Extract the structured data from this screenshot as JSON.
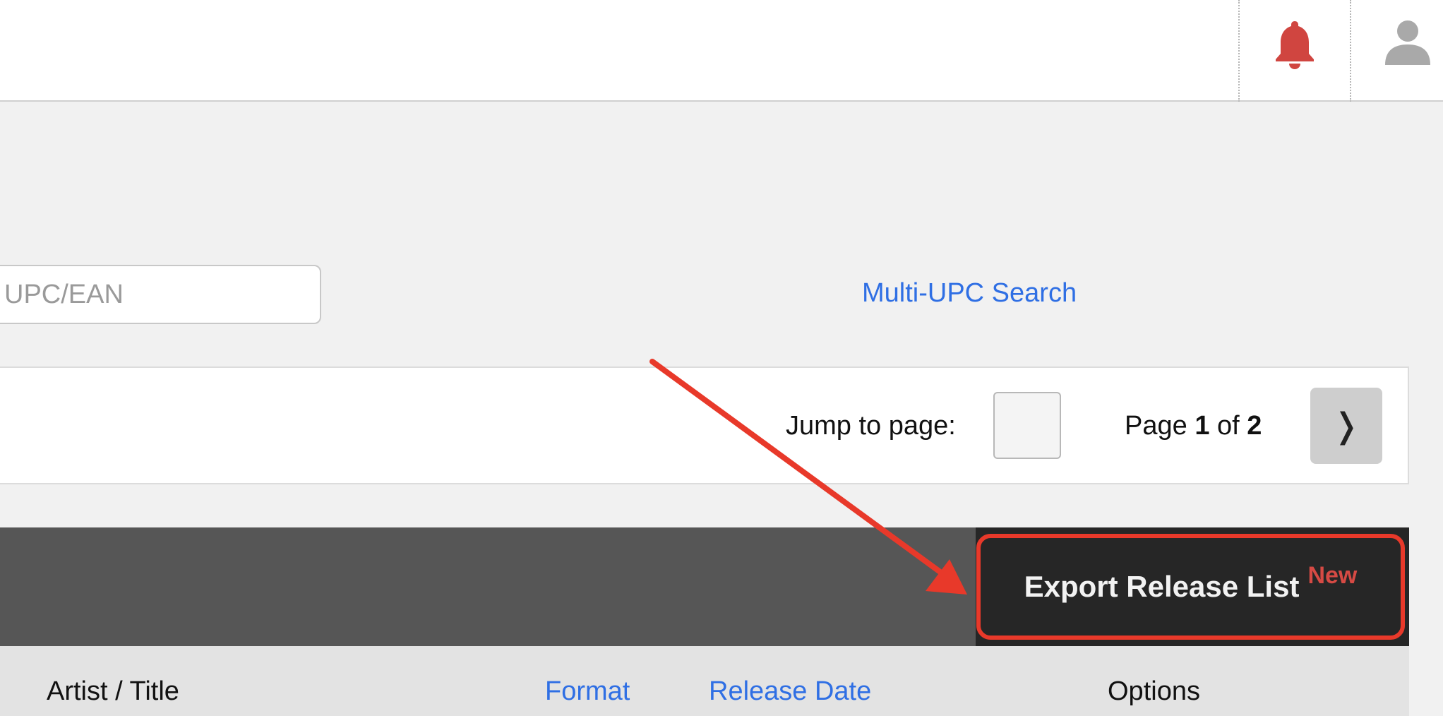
{
  "header": {
    "notification_icon": "bell-icon",
    "notification_color": "#d04540",
    "user_icon": "user-icon"
  },
  "search": {
    "upc_placeholder": "UPC/EAN",
    "multi_upc_link": "Multi-UPC Search"
  },
  "pagination": {
    "jump_label": "Jump to page:",
    "jump_value": "",
    "page_prefix": "Page",
    "current_page": "1",
    "page_of": "of",
    "total_pages": "2",
    "next_glyph": "❭"
  },
  "export": {
    "label": "Export Release List",
    "badge": "New",
    "highlight_color": "#e8392a"
  },
  "table": {
    "columns": [
      {
        "label": "Artist / Title",
        "sortable": false
      },
      {
        "label": "Format",
        "sortable": true
      },
      {
        "label": "Release Date",
        "sortable": true
      },
      {
        "label": "Options",
        "sortable": false
      }
    ]
  },
  "colors": {
    "link": "#2f6fe4",
    "dark_bar": "#565656",
    "export_bg": "#262626"
  }
}
